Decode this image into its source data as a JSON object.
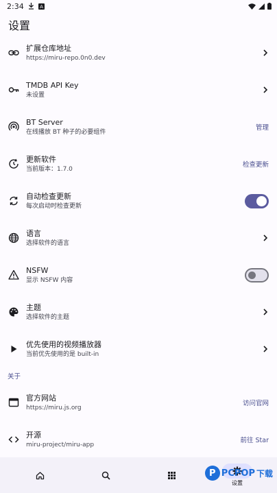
{
  "status_bar": {
    "time": "2:34"
  },
  "page_title": "设置",
  "settings": [
    {
      "key": "repo",
      "icon": "link-icon",
      "title": "扩展仓库地址",
      "subtitle": "https://miru-repo.0n0.dev",
      "trailing": "chevron"
    },
    {
      "key": "tmdb",
      "icon": "key-icon",
      "title": "TMDB API Key",
      "subtitle": "未设置",
      "trailing": "chevron"
    },
    {
      "key": "bt",
      "icon": "podcast-icon",
      "title": "BT Server",
      "subtitle": "在线播放 BT 种子的必要组件",
      "trailing": "text",
      "trailing_text": "管理"
    },
    {
      "key": "update",
      "icon": "update-clock-icon",
      "title": "更新软件",
      "subtitle": "当前版本：1.7.0",
      "trailing": "text",
      "trailing_text": "检查更新"
    },
    {
      "key": "auto_update",
      "icon": "sync-icon",
      "title": "自动检查更新",
      "subtitle": "每次启动时检查更新",
      "trailing": "toggle",
      "toggle_on": true
    },
    {
      "key": "language",
      "icon": "globe-icon",
      "title": "语言",
      "subtitle": "选择软件的语言",
      "trailing": "chevron"
    },
    {
      "key": "nsfw",
      "icon": "warning-icon",
      "title": "NSFW",
      "subtitle": "显示 NSFW 内容",
      "trailing": "toggle",
      "toggle_on": false
    },
    {
      "key": "theme",
      "icon": "palette-icon",
      "title": "主题",
      "subtitle": "选择软件的主题",
      "trailing": "chevron"
    },
    {
      "key": "player",
      "icon": "play-icon",
      "title": "优先使用的视频播放器",
      "subtitle": "当前优先使用的是 built-in",
      "trailing": "chevron"
    }
  ],
  "about_header": "关于",
  "about": [
    {
      "key": "website",
      "icon": "browser-window-icon",
      "title": "官方网站",
      "subtitle": "https://miru.js.org",
      "trailing": "text",
      "trailing_text": "访问官网"
    },
    {
      "key": "source",
      "icon": "code-icon",
      "title": "开源",
      "subtitle": "miru-project/miru-app",
      "trailing": "text",
      "trailing_text": "前往 Star"
    }
  ],
  "bottom_nav": {
    "items": [
      {
        "icon": "home-icon",
        "label": ""
      },
      {
        "icon": "search-icon",
        "label": ""
      },
      {
        "icon": "grid-icon",
        "label": ""
      },
      {
        "icon": "gear-icon",
        "label": "设置",
        "active": true
      }
    ]
  },
  "watermark": {
    "logo": "P",
    "brand": "PCPOP",
    "suffix": "下载"
  },
  "colors": {
    "accent": "#5b5b9f",
    "background": "#fdfbff",
    "nav_background": "#f3f1f9"
  }
}
